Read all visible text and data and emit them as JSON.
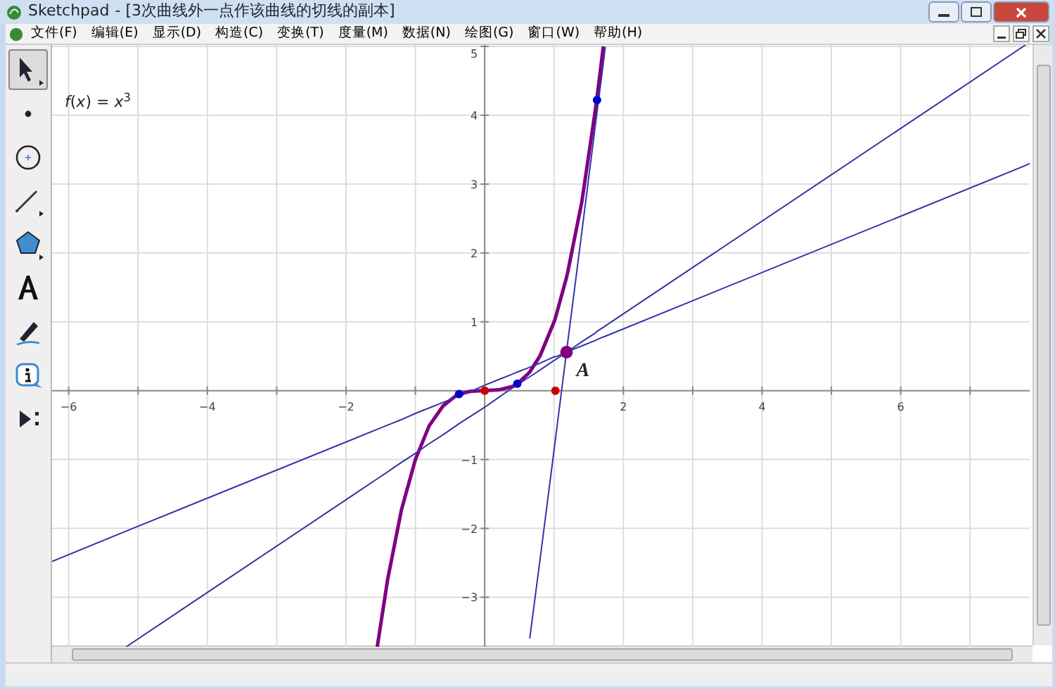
{
  "window": {
    "app": "Sketchpad",
    "document": "- [3次曲线外一点作该曲线的切线的副本]"
  },
  "menu": [
    "文件(F)",
    "编辑(E)",
    "显示(D)",
    "构造(C)",
    "变换(T)",
    "度量(M)",
    "数据(N)",
    "绘图(G)",
    "窗口(W)",
    "帮助(H)"
  ],
  "toolbox": [
    {
      "kind": "arrow",
      "selected": true
    },
    {
      "kind": "point",
      "selected": false
    },
    {
      "kind": "compass",
      "selected": false
    },
    {
      "kind": "line",
      "selected": false
    },
    {
      "kind": "polygon",
      "selected": false
    },
    {
      "kind": "text",
      "selected": false
    },
    {
      "kind": "marker",
      "selected": false
    },
    {
      "kind": "info",
      "selected": false
    },
    {
      "kind": "custom",
      "selected": false
    }
  ],
  "canvas": {
    "function_label": "*f*(*x*) = *x*$^{3}$",
    "chart_data": {
      "type": "line",
      "grid": true,
      "x": [
        -6.24,
        -5.17,
        -1.55,
        -1.4,
        -1.2,
        -1,
        -0.8,
        -0.6,
        -0.4,
        -0.37,
        -0.2,
        0,
        0.2,
        0.4,
        0.47,
        0.6,
        0.65,
        0.8,
        1,
        1.02,
        1.18,
        1.2,
        1.4,
        1.6,
        1.62,
        1.71,
        1.74,
        7.8,
        7.86
      ],
      "xlim": [
        -6.24,
        7.86
      ],
      "ylim": [
        -3.72,
        5.02
      ],
      "xticks": [
        -6,
        -4,
        -2,
        2,
        4,
        6
      ],
      "yticks": [
        -3,
        -2,
        -1,
        1,
        2,
        3,
        4,
        5
      ],
      "series": [
        {
          "color": "#800080",
          "values": [
            null,
            null,
            -3.72,
            -2.74,
            -1.73,
            -1,
            -0.51,
            -0.22,
            -0.06,
            -0.05,
            -0.01,
            0,
            0.01,
            0.06,
            0.1,
            0.22,
            0.27,
            0.51,
            1,
            1.06,
            1.64,
            1.73,
            2.74,
            4.1,
            4.25,
            5.0,
            null,
            null,
            null
          ]
        },
        {
          "color": "#3333aa",
          "values": [
            -2.48,
            -2.04,
            -0.56,
            -0.5,
            -0.42,
            -0.33,
            -0.25,
            -0.17,
            -0.09,
            -0.08,
            -0.01,
            0.08,
            0.16,
            0.24,
            0.27,
            0.32,
            0.34,
            0.4,
            0.49,
            0.49,
            0.56,
            0.57,
            0.65,
            0.73,
            0.74,
            0.78,
            0.79,
            3.27,
            3.3
          ]
        },
        {
          "color": "#3333aa",
          "values": [
            null,
            -3.72,
            -1.28,
            -1.18,
            -1.04,
            -0.91,
            -0.77,
            -0.64,
            -0.5,
            -0.48,
            -0.37,
            -0.24,
            -0.1,
            0.04,
            0.08,
            0.17,
            0.2,
            0.3,
            0.44,
            0.45,
            0.56,
            0.57,
            0.71,
            0.84,
            0.86,
            0.92,
            0.94,
            5.02,
            null
          ]
        },
        {
          "color": "#3333aa",
          "values": [
            null,
            null,
            null,
            null,
            null,
            null,
            null,
            null,
            null,
            null,
            null,
            null,
            null,
            null,
            null,
            null,
            -3.6,
            -2.44,
            -0.86,
            -0.7,
            0.56,
            0.72,
            2.3,
            3.88,
            4.04,
            4.75,
            4.99,
            null,
            null
          ]
        },
        {
          "marker": true,
          "color": "#0000cc",
          "values": [
            null,
            null,
            null,
            null,
            null,
            null,
            null,
            null,
            null,
            -0.05,
            null,
            null,
            null,
            null,
            0.1,
            null,
            null,
            null,
            null,
            null,
            null,
            null,
            null,
            null,
            4.22,
            null,
            null,
            null,
            null
          ]
        },
        {
          "marker": true,
          "color": "#cc0000",
          "values": [
            null,
            null,
            null,
            null,
            null,
            null,
            null,
            null,
            null,
            null,
            null,
            0,
            null,
            null,
            null,
            null,
            null,
            null,
            null,
            0,
            null,
            null,
            null,
            null,
            null,
            null,
            null,
            null,
            null
          ]
        },
        {
          "marker": true,
          "name": "A",
          "color": "#800080",
          "values": [
            null,
            null,
            null,
            null,
            null,
            null,
            null,
            null,
            null,
            null,
            null,
            null,
            null,
            null,
            null,
            null,
            null,
            null,
            null,
            null,
            0.56,
            null,
            null,
            null,
            null,
            null,
            null,
            null,
            null
          ]
        }
      ]
    }
  }
}
